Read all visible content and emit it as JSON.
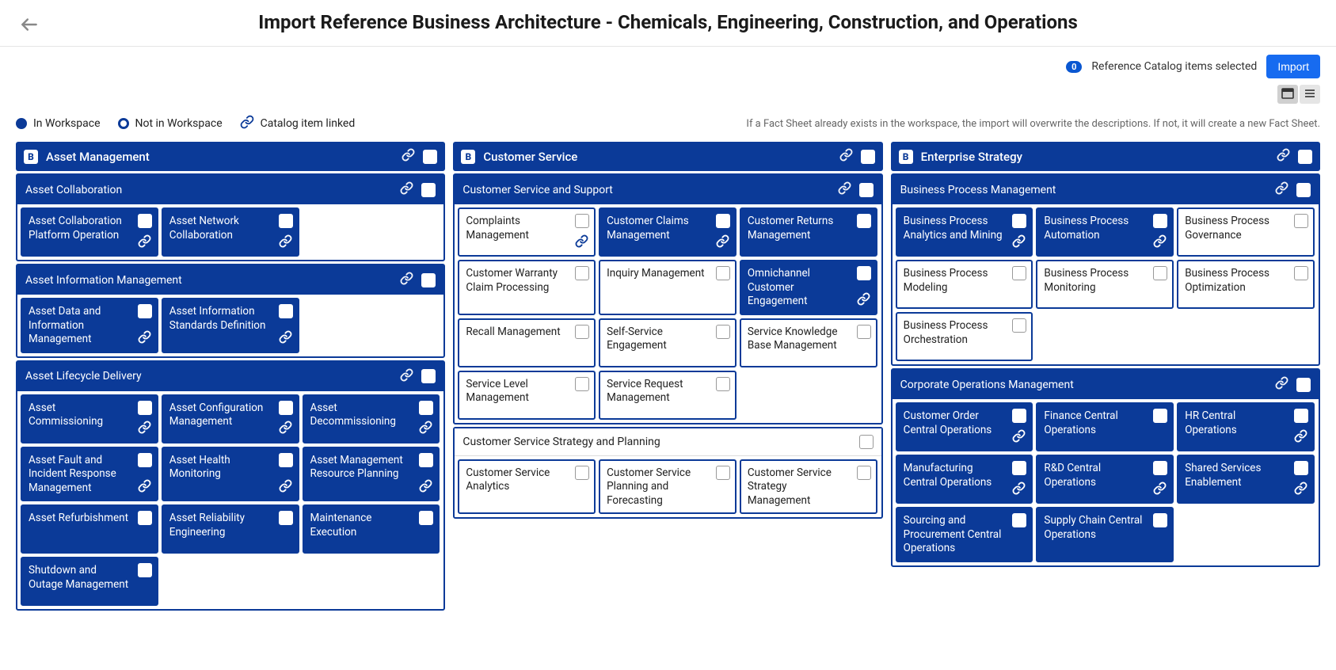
{
  "page_title": "Import Reference Business Architecture - Chemicals, Engineering, Construction, and Operations",
  "toolbar": {
    "selected_count": "0",
    "selected_label": "Reference Catalog items selected",
    "import_label": "Import"
  },
  "legend": {
    "in_workspace": "In Workspace",
    "not_in_workspace": "Not in Workspace",
    "linked": "Catalog item linked",
    "hint": "If a Fact Sheet already exists in the workspace, the import will overwrite the descriptions. If not, it will create a new Fact Sheet."
  },
  "columns": [
    {
      "title": "Asset Management",
      "top_link": true,
      "groups": [
        {
          "title": "Asset Collaboration",
          "filled": true,
          "link": true,
          "cards": [
            {
              "title": "Asset Collaboration Platform Operation",
              "filled": true,
              "link": true
            },
            {
              "title": "Asset Network Collaboration",
              "filled": true,
              "link": true
            }
          ]
        },
        {
          "title": "Asset Information Management",
          "filled": true,
          "link": true,
          "cards": [
            {
              "title": "Asset Data and Information Management",
              "filled": true,
              "link": true
            },
            {
              "title": "Asset Information Standards Definition",
              "filled": true,
              "link": true
            }
          ]
        },
        {
          "title": "Asset Lifecycle Delivery",
          "filled": true,
          "link": true,
          "cards": [
            {
              "title": "Asset Commissioning",
              "filled": true,
              "link": true
            },
            {
              "title": "Asset Configuration Management",
              "filled": true,
              "link": true
            },
            {
              "title": "Asset Decommissioning",
              "filled": true,
              "link": true
            },
            {
              "title": "Asset Fault and Incident Response Management",
              "filled": true,
              "link": true
            },
            {
              "title": "Asset Health Monitoring",
              "filled": true,
              "link": true
            },
            {
              "title": "Asset Management Resource Planning",
              "filled": true,
              "link": true
            },
            {
              "title": "Asset Refurbishment",
              "filled": true,
              "link": false
            },
            {
              "title": "Asset Reliability Engineering",
              "filled": true,
              "link": false
            },
            {
              "title": "Maintenance Execution",
              "filled": true,
              "link": false
            },
            {
              "title": "Shutdown and Outage Management",
              "filled": true,
              "link": false
            }
          ]
        }
      ]
    },
    {
      "title": "Customer Service",
      "top_link": true,
      "groups": [
        {
          "title": "Customer Service and Support",
          "filled": true,
          "link": true,
          "cards": [
            {
              "title": "Complaints Management",
              "filled": false,
              "link": true
            },
            {
              "title": "Customer Claims Management",
              "filled": true,
              "link": true
            },
            {
              "title": "Customer Returns Management",
              "filled": true,
              "link": false
            },
            {
              "title": "Customer Warranty Claim Processing",
              "filled": false,
              "link": false
            },
            {
              "title": "Inquiry Management",
              "filled": false,
              "link": false
            },
            {
              "title": "Omnichannel Customer Engagement",
              "filled": true,
              "link": true
            },
            {
              "title": "Recall Management",
              "filled": false,
              "link": false
            },
            {
              "title": "Self-Service Engagement",
              "filled": false,
              "link": false
            },
            {
              "title": "Service Knowledge Base Management",
              "filled": false,
              "link": false
            },
            {
              "title": "Service Level Management",
              "filled": false,
              "link": false
            },
            {
              "title": "Service Request Management",
              "filled": false,
              "link": false
            }
          ]
        },
        {
          "title": "Customer Service Strategy and Planning",
          "filled": false,
          "link": false,
          "cards": [
            {
              "title": "Customer Service Analytics",
              "filled": false,
              "link": false
            },
            {
              "title": "Customer Service Planning and Forecasting",
              "filled": false,
              "link": false
            },
            {
              "title": "Customer Service Strategy Management",
              "filled": false,
              "link": false
            }
          ]
        }
      ]
    },
    {
      "title": "Enterprise Strategy",
      "top_link": true,
      "groups": [
        {
          "title": "Business Process Management",
          "filled": true,
          "link": true,
          "cards": [
            {
              "title": "Business Process Analytics and Mining",
              "filled": true,
              "link": true
            },
            {
              "title": "Business Process Automation",
              "filled": true,
              "link": true
            },
            {
              "title": "Business Process Governance",
              "filled": false,
              "link": false
            },
            {
              "title": "Business Process Modeling",
              "filled": false,
              "link": false
            },
            {
              "title": "Business Process Monitoring",
              "filled": false,
              "link": false
            },
            {
              "title": "Business Process Optimization",
              "filled": false,
              "link": false
            },
            {
              "title": "Business Process Orchestration",
              "filled": false,
              "link": false
            }
          ]
        },
        {
          "title": "Corporate Operations Management",
          "filled": true,
          "link": true,
          "cards": [
            {
              "title": "Customer Order Central Operations",
              "filled": true,
              "link": true
            },
            {
              "title": "Finance Central Operations",
              "filled": true,
              "link": false
            },
            {
              "title": "HR Central Operations",
              "filled": true,
              "link": true
            },
            {
              "title": "Manufacturing Central Operations",
              "filled": true,
              "link": true
            },
            {
              "title": "R&D Central Operations",
              "filled": true,
              "link": true
            },
            {
              "title": "Shared Services Enablement",
              "filled": true,
              "link": true
            },
            {
              "title": "Sourcing and Procurement Central Operations",
              "filled": true,
              "link": false
            },
            {
              "title": "Supply Chain Central Operations",
              "filled": true,
              "link": false
            }
          ]
        }
      ]
    }
  ]
}
